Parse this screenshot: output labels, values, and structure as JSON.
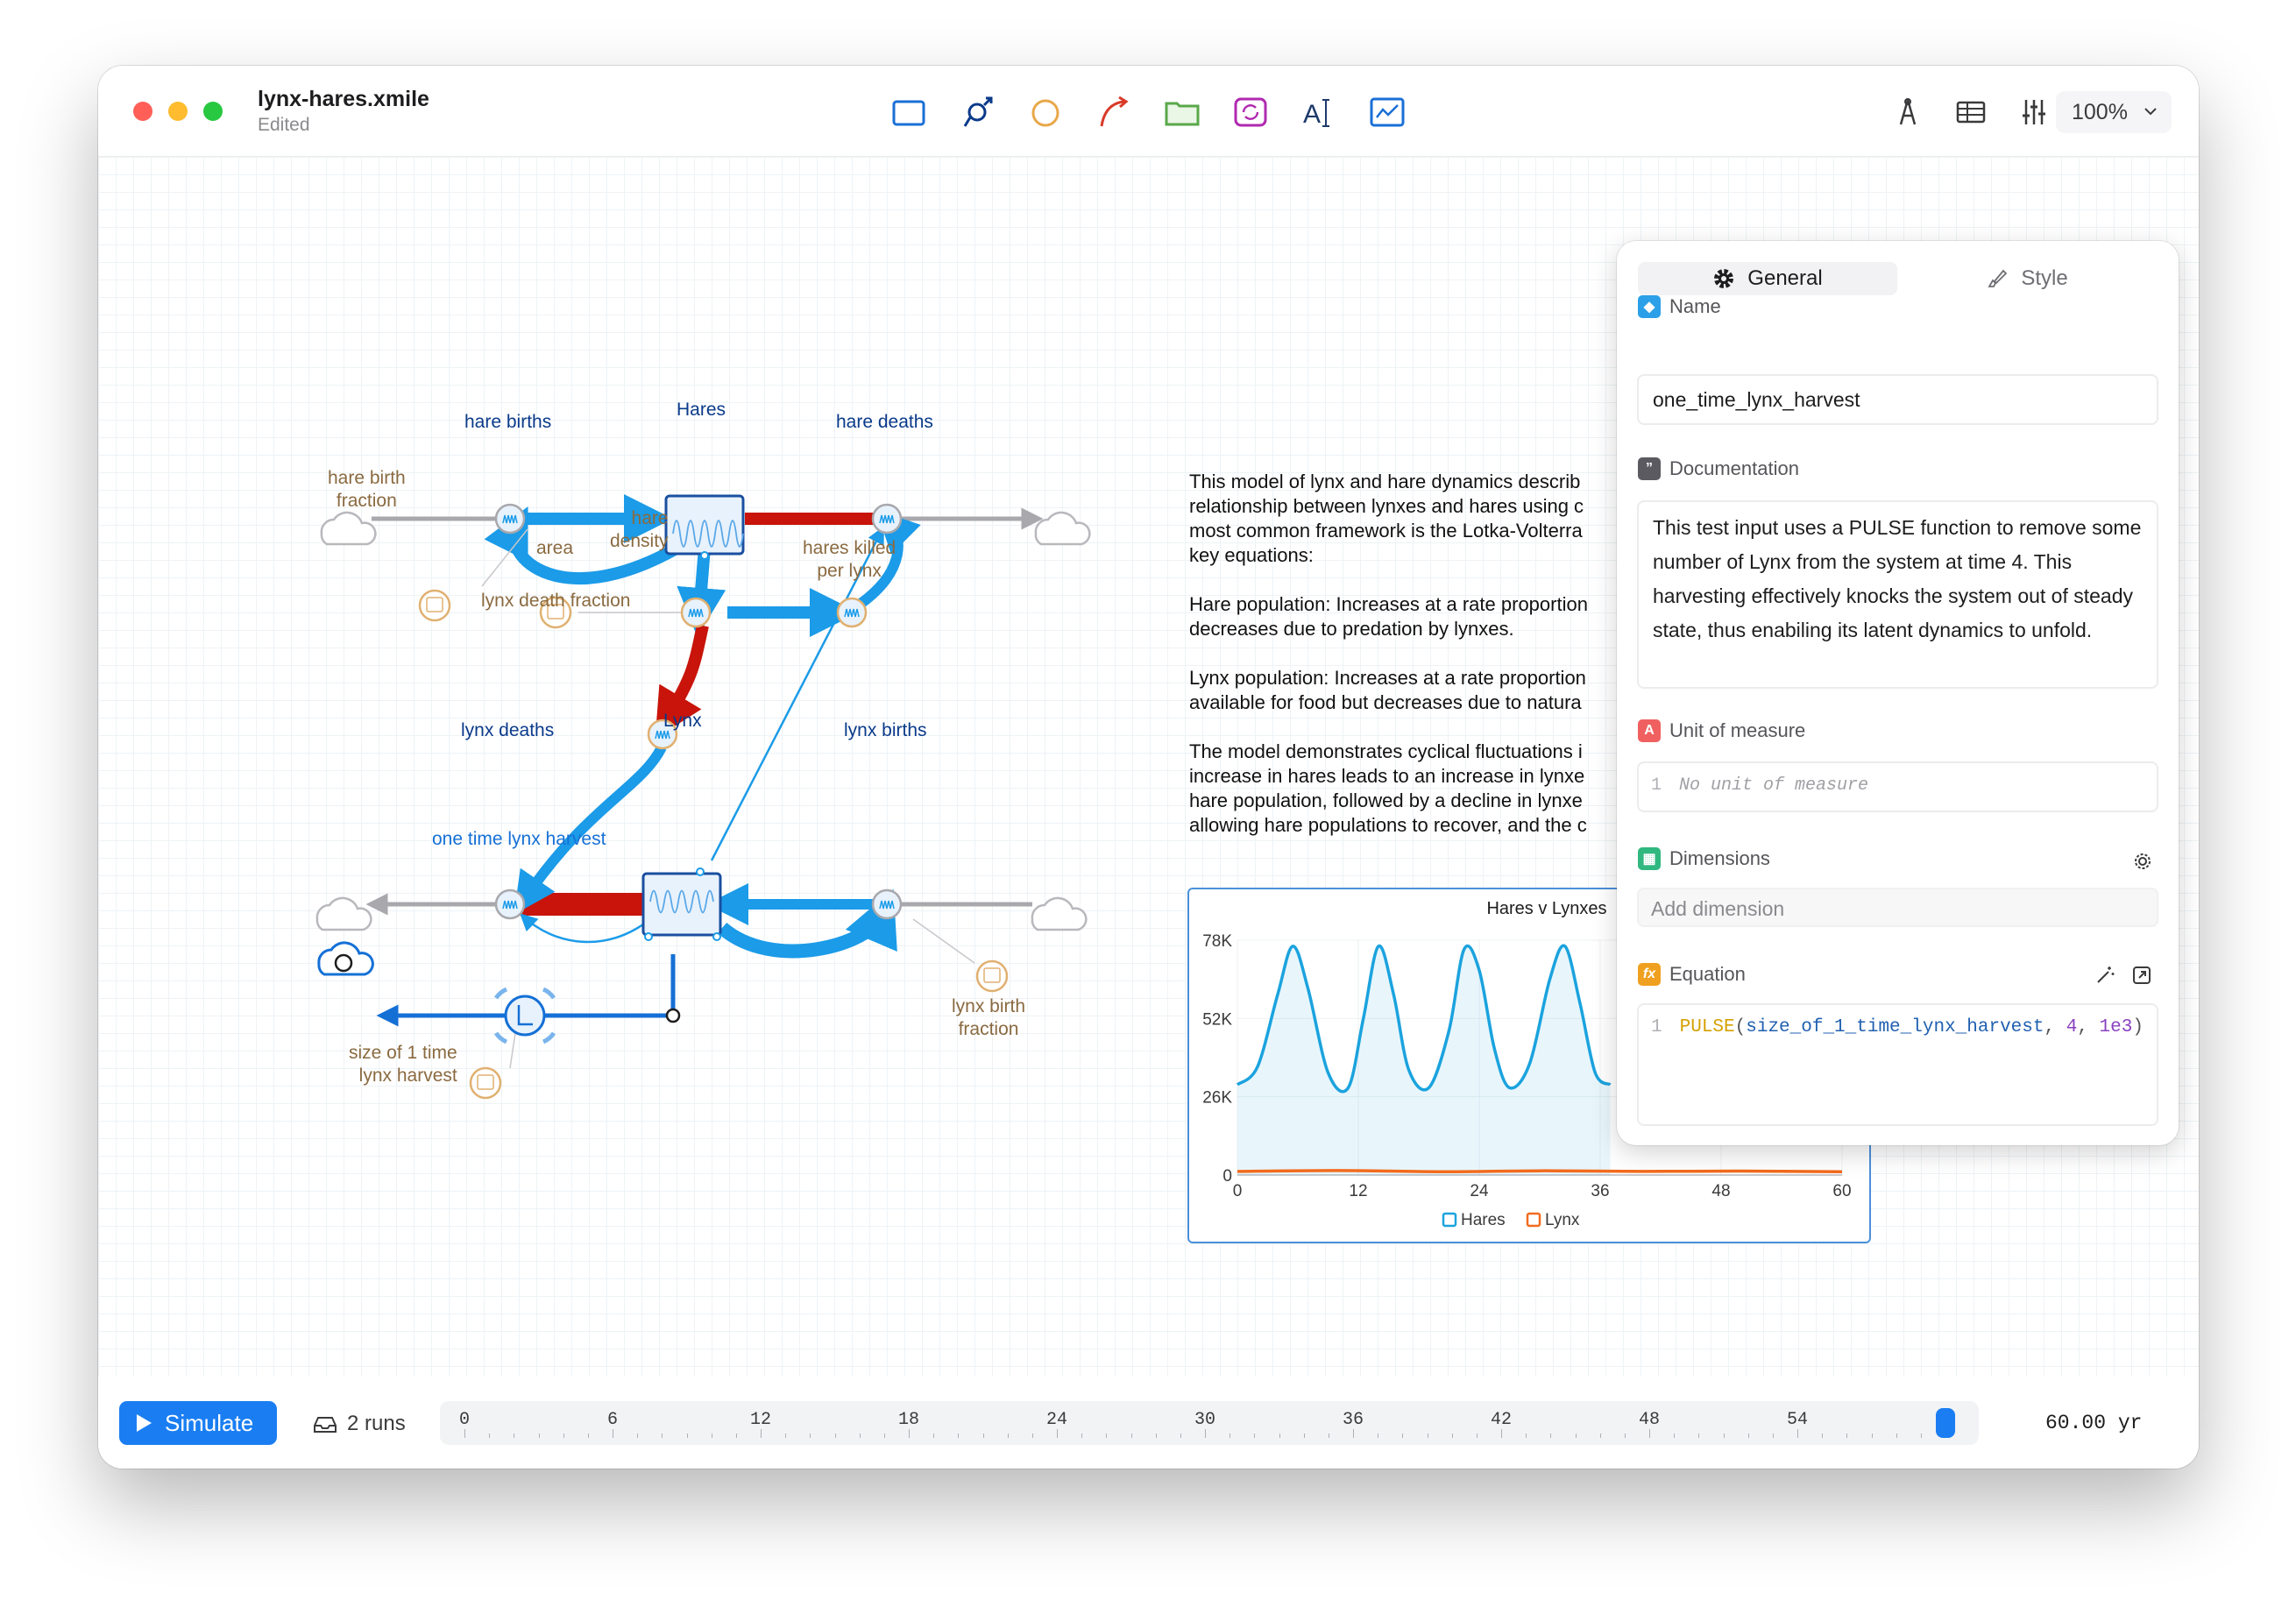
{
  "window": {
    "title": "lynx-hares.xmile",
    "subtitle": "Edited"
  },
  "toolbar": {
    "tools": [
      "stock-tool-icon",
      "flow-tool-icon",
      "variable-tool-icon",
      "link-tool-icon",
      "module-tool-icon",
      "loop-tool-icon",
      "text-tool-icon",
      "chart-tool-icon"
    ],
    "right": [
      "format-icon",
      "table-icon",
      "sliders-icon"
    ],
    "zoom": "100%"
  },
  "diagram": {
    "labels": {
      "hare_births": "hare births",
      "hares": "Hares",
      "hare_deaths": "hare deaths",
      "hare_birth_fraction": "hare birth\nfraction",
      "hare_density": "hare\ndensity",
      "area": "area",
      "hares_killed": "hares killed\nper lynx",
      "lynx_death_fraction": "lynx death fraction",
      "lynx": "Lynx",
      "lynx_deaths": "lynx deaths",
      "lynx_births": "lynx births",
      "lynx_birth_fraction": "lynx birth\nfraction",
      "harvest": "one time lynx harvest",
      "size_harvest": "size of 1 time\nlynx harvest"
    },
    "colors": {
      "positive": "#1b9be8",
      "negative": "#c8140a",
      "harvest": "#1570d6",
      "aux": "#e0b070"
    }
  },
  "description": {
    "paragraphs": [
      "This model of lynx and hare dynamics describ\nrelationship between lynxes and hares using c\nmost common framework is the Lotka-Volterra\nkey equations:",
      "Hare population: Increases at a rate proportion\ndecreases due to predation by lynxes.",
      "Lynx population: Increases at a rate proportion\navailable for food but decreases due to natura",
      "The model demonstrates cyclical fluctuations i\nincrease in hares leads to an increase in lynxe\nhare population, followed by a decline in lynxe\nallowing hare populations to recover, and the c"
    ]
  },
  "chart_data": {
    "type": "line",
    "title": "Hares v Lynxes",
    "xlim": [
      0,
      60
    ],
    "ylim": [
      0,
      78000
    ],
    "x_ticks": [
      "0",
      "12",
      "24",
      "36",
      "48",
      "60"
    ],
    "y_ticks": [
      "0",
      "26K",
      "52K",
      "78K"
    ],
    "series": [
      {
        "name": "Hares",
        "color": "#1ba3de",
        "x": [
          0,
          2,
          4,
          5.5,
          7,
          9,
          11,
          12.5,
          14,
          15.5,
          17,
          19,
          21,
          22.5,
          24,
          25.5,
          27,
          29,
          31,
          32.5,
          34,
          35.5,
          37
        ],
        "y": [
          30000,
          36000,
          60000,
          76000,
          62000,
          34000,
          29000,
          52000,
          76000,
          60000,
          35000,
          29000,
          48000,
          75000,
          68000,
          42000,
          29000,
          37000,
          65000,
          76000,
          57000,
          34000,
          30000
        ]
      },
      {
        "name": "Lynx",
        "color": "#f26b1d",
        "x": [
          0,
          10,
          20,
          30,
          40,
          50,
          60
        ],
        "y": [
          1200,
          1500,
          1100,
          1400,
          1200,
          1300,
          1100
        ]
      }
    ],
    "legend": "bottom"
  },
  "panel": {
    "tabs": {
      "general": "General",
      "style": "Style"
    },
    "name_label": "Name",
    "name_value": "one_time_lynx_harvest",
    "doc_label": "Documentation",
    "doc_value": "This test input uses a PULSE function to remove some number of Lynx from the system at time 4. This harvesting effectively knocks the system out of steady state, thus enabiling its latent dynamics to unfold.",
    "unit_label": "Unit of measure",
    "unit_line": "1",
    "unit_placeholder": "No unit of measure",
    "dim_label": "Dimensions",
    "dim_placeholder": "Add dimension",
    "eq_label": "Equation",
    "eq_line": "1",
    "eq_fn": "PULSE",
    "eq_open": "(",
    "eq_arg": "size_of_1_time_lynx_harvest",
    "eq_sep1": ", ",
    "eq_n1": "4",
    "eq_sep2": ", ",
    "eq_n2": "1e3",
    "eq_close": ")"
  },
  "bottom": {
    "simulate": "Simulate",
    "runs": "2 runs",
    "ticks": [
      "0",
      "6",
      "12",
      "18",
      "24",
      "30",
      "36",
      "42",
      "48",
      "54"
    ],
    "time": "60.00 yr",
    "position": 1.0
  }
}
